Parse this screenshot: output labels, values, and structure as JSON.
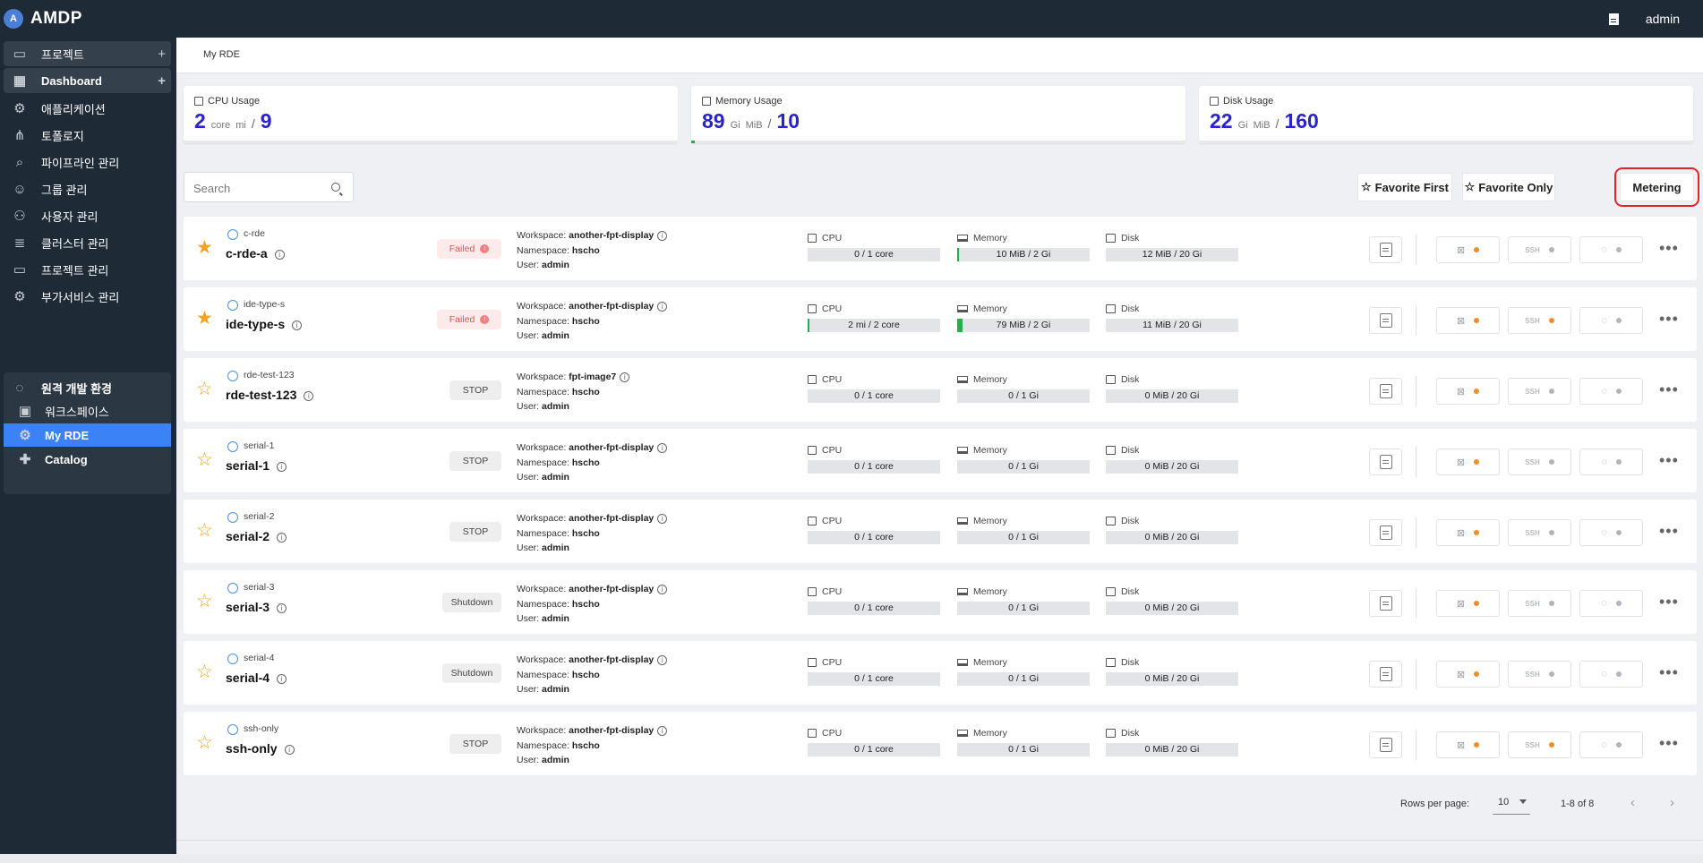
{
  "app": {
    "name": "AMDP",
    "logo_letter": "A",
    "user": "admin"
  },
  "sidebar": {
    "items": [
      {
        "label": "프로젝트",
        "icon": "folder-icon",
        "group": true,
        "plus": "+"
      },
      {
        "label": "Dashboard",
        "icon": "dashboard-icon",
        "group": true,
        "plus": "+",
        "bold": true
      },
      {
        "label": "애플리케이션",
        "icon": "gear-icon"
      },
      {
        "label": "토폴로지",
        "icon": "topology-icon"
      },
      {
        "label": "파이프라인 관리",
        "icon": "pipeline-icon"
      },
      {
        "label": "그룹 관리",
        "icon": "group-icon"
      },
      {
        "label": "사용자 관리",
        "icon": "user-settings-icon"
      },
      {
        "label": "클러스터 관리",
        "icon": "cluster-icon"
      },
      {
        "label": "프로젝트 관리",
        "icon": "folder-icon"
      },
      {
        "label": "부가서비스 관리",
        "icon": "addon-icon"
      }
    ],
    "rde_group": "원격 개발 환경",
    "rde_items": [
      {
        "label": "워크스페이스",
        "icon": "monitor-icon"
      },
      {
        "label": "My RDE",
        "icon": "gear-icon",
        "active": true
      },
      {
        "label": "Catalog",
        "icon": "puzzle-icon"
      }
    ]
  },
  "breadcrumb": "My RDE",
  "usage": [
    {
      "title": "CPU Usage",
      "value": "2",
      "units": [
        "core",
        "mi"
      ],
      "sep": "/",
      "total": "9",
      "fill": 0
    },
    {
      "title": "Memory Usage",
      "value": "89",
      "units": [
        "Gi",
        "MiB"
      ],
      "sep": "/",
      "total": "10",
      "fill": 0.008
    },
    {
      "title": "Disk Usage",
      "value": "22",
      "units": [
        "Gi",
        "MiB"
      ],
      "sep": "/",
      "total": "160",
      "fill": 0
    }
  ],
  "search": {
    "placeholder": "Search"
  },
  "toolbar": {
    "favorite_first": "Favorite First",
    "favorite_only": "Favorite Only",
    "metering": "Metering",
    "star": "☆"
  },
  "labels": {
    "workspace": "Workspace:",
    "namespace": "Namespace:",
    "user": "User:",
    "cpu": "CPU",
    "memory": "Memory",
    "disk": "Disk",
    "info": "i",
    "more": "•••",
    "ssh": "SSH",
    "vscode": "⊠",
    "jupyter": "◌"
  },
  "rows": [
    {
      "sub": "c-rde",
      "name": "c-rde-a",
      "fav": true,
      "status": "Failed",
      "status_type": "failed",
      "workspace": "another-fpt-display",
      "namespace": "hscho",
      "user": "admin",
      "cpu": "0 / 1 core",
      "cpu_fill": 0,
      "memory": "10 MiB / 2 Gi",
      "mem_fill": 0.005,
      "disk": "12 MiB / 20 Gi",
      "disk_fill": 0,
      "vscode_on": true,
      "ssh_on": false,
      "jupyter_on": false
    },
    {
      "sub": "ide-type-s",
      "name": "ide-type-s",
      "fav": true,
      "status": "Failed",
      "status_type": "failed",
      "workspace": "another-fpt-display",
      "namespace": "hscho",
      "user": "admin",
      "cpu": "2 mi / 2 core",
      "cpu_fill": 0.001,
      "memory": "79 MiB / 2 Gi",
      "mem_fill": 0.039,
      "disk": "11 MiB / 20 Gi",
      "disk_fill": 0,
      "vscode_on": true,
      "ssh_on": true,
      "jupyter_on": false
    },
    {
      "sub": "rde-test-123",
      "name": "rde-test-123",
      "fav": false,
      "status": "STOP",
      "status_type": "stop",
      "workspace": "fpt-image7",
      "namespace": "hscho",
      "user": "admin",
      "cpu": "0 / 1 core",
      "cpu_fill": 0,
      "memory": "0 / 1 Gi",
      "mem_fill": 0,
      "disk": "0 MiB / 20 Gi",
      "disk_fill": 0,
      "vscode_on": true,
      "ssh_on": false,
      "jupyter_on": false
    },
    {
      "sub": "serial-1",
      "name": "serial-1",
      "fav": false,
      "status": "STOP",
      "status_type": "stop",
      "workspace": "another-fpt-display",
      "namespace": "hscho",
      "user": "admin",
      "cpu": "0 / 1 core",
      "cpu_fill": 0,
      "memory": "0 / 1 Gi",
      "mem_fill": 0,
      "disk": "0 MiB / 20 Gi",
      "disk_fill": 0,
      "vscode_on": true,
      "ssh_on": false,
      "jupyter_on": false
    },
    {
      "sub": "serial-2",
      "name": "serial-2",
      "fav": false,
      "status": "STOP",
      "status_type": "stop",
      "workspace": "another-fpt-display",
      "namespace": "hscho",
      "user": "admin",
      "cpu": "0 / 1 core",
      "cpu_fill": 0,
      "memory": "0 / 1 Gi",
      "mem_fill": 0,
      "disk": "0 MiB / 20 Gi",
      "disk_fill": 0,
      "vscode_on": true,
      "ssh_on": false,
      "jupyter_on": false
    },
    {
      "sub": "serial-3",
      "name": "serial-3",
      "fav": false,
      "status": "Shutdown",
      "status_type": "stop",
      "workspace": "another-fpt-display",
      "namespace": "hscho",
      "user": "admin",
      "cpu": "0 / 1 core",
      "cpu_fill": 0,
      "memory": "0 / 1 Gi",
      "mem_fill": 0,
      "disk": "0 MiB / 20 Gi",
      "disk_fill": 0,
      "vscode_on": true,
      "ssh_on": false,
      "jupyter_on": false
    },
    {
      "sub": "serial-4",
      "name": "serial-4",
      "fav": false,
      "status": "Shutdown",
      "status_type": "stop",
      "workspace": "another-fpt-display",
      "namespace": "hscho",
      "user": "admin",
      "cpu": "0 / 1 core",
      "cpu_fill": 0,
      "memory": "0 / 1 Gi",
      "mem_fill": 0,
      "disk": "0 MiB / 20 Gi",
      "disk_fill": 0,
      "vscode_on": true,
      "ssh_on": false,
      "jupyter_on": false
    },
    {
      "sub": "ssh-only",
      "name": "ssh-only",
      "fav": false,
      "status": "STOP",
      "status_type": "stop",
      "workspace": "another-fpt-display",
      "namespace": "hscho",
      "user": "admin",
      "cpu": "0 / 1 core",
      "cpu_fill": 0,
      "memory": "0 / 1 Gi",
      "mem_fill": 0,
      "disk": "0 MiB / 20 Gi",
      "disk_fill": 0,
      "vscode_on": true,
      "ssh_on": true,
      "jupyter_on": false
    }
  ],
  "pagination": {
    "rows_per_page_label": "Rows per page:",
    "rows_per_page": "10",
    "range": "1-8 of 8",
    "prev": "‹",
    "next": "›"
  },
  "colors": {
    "accent": "#3b82f6",
    "value": "#2b23c9",
    "star": "#f2a51c",
    "failed": "#e05252",
    "usage_fill": "#22b04a",
    "highlight": "#e0242a"
  }
}
